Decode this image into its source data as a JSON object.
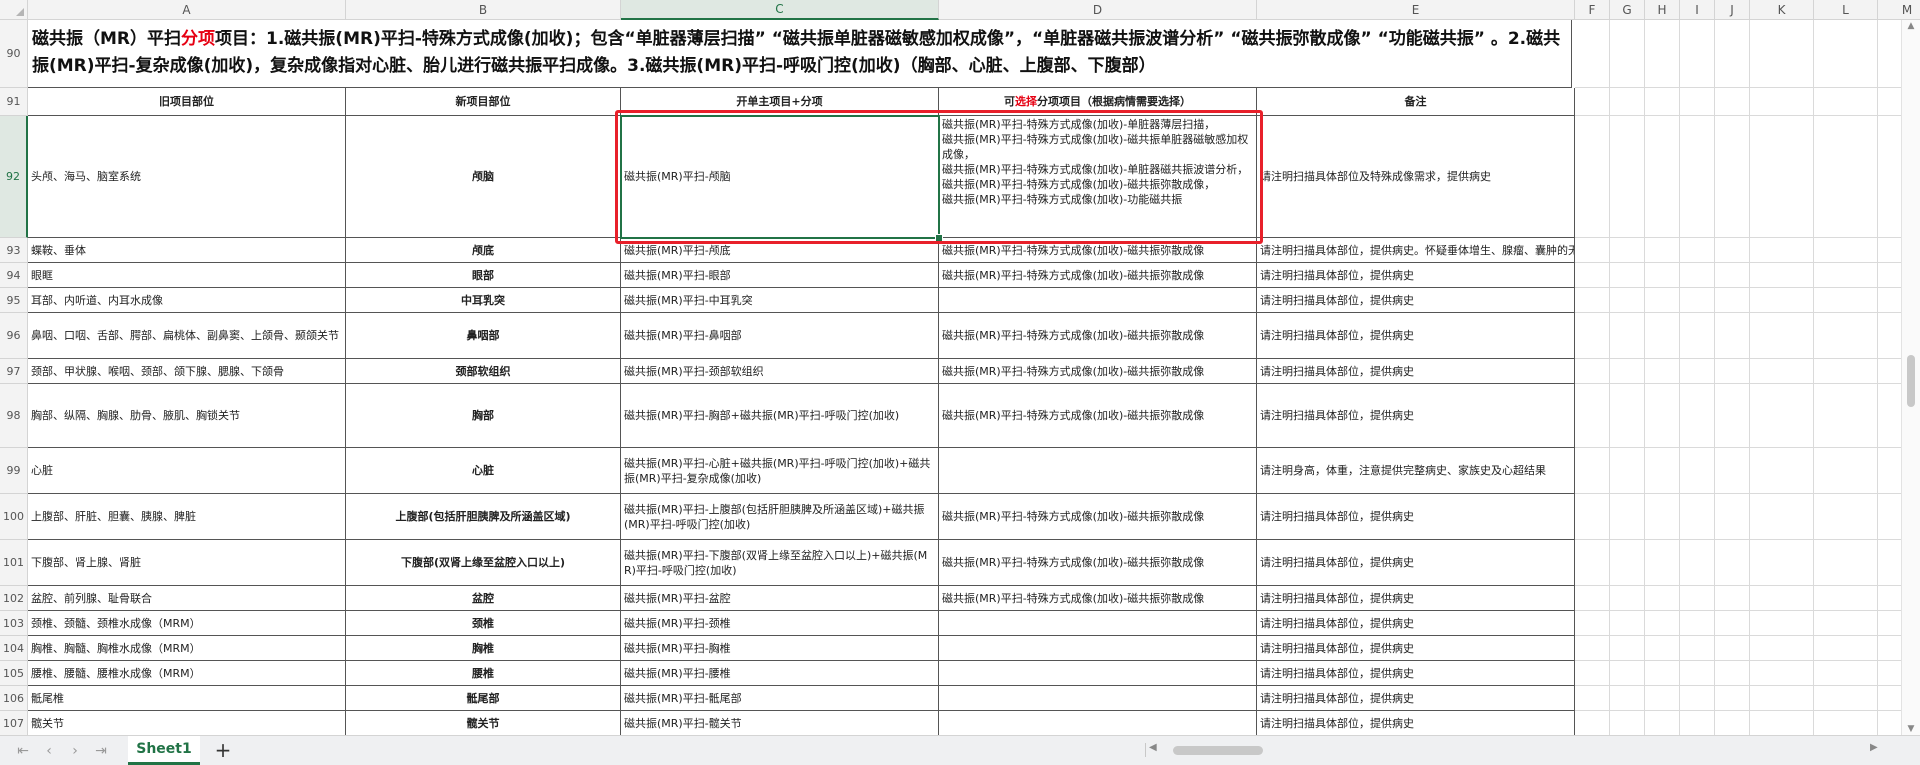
{
  "columns": [
    "A",
    "B",
    "C",
    "D",
    "E",
    "F",
    "G",
    "H",
    "I",
    "J",
    "K",
    "L",
    "M"
  ],
  "active_column": "C",
  "title": {
    "row": "90",
    "parts": [
      {
        "t": "磁共振（MR）平扫",
        "red": false
      },
      {
        "t": "分项",
        "red": true
      },
      {
        "t": "项目：1.磁共振(MR)平扫-特殊方式成像(加收)；包含“单脏器薄层扫描” “磁共振单脏器磁敏感加权成像”，“单脏器磁共振波谱分析” “磁共振弥散成像” “功能磁共振” 。2.磁共振(MR)平扫-复杂成像(加收)，复杂成像指对心脏、胎儿进行磁共振平扫成像。3.磁共振(MR)平扫-呼吸门控(加收)（胸部、心脏、上腹部、下腹部）",
        "red": false
      }
    ]
  },
  "header": {
    "row": "91",
    "cells": [
      {
        "text": "旧项目部位"
      },
      {
        "text": "新项目部位"
      },
      {
        "text": "开单主项目+分项"
      },
      {
        "pre": "可",
        "red": "选择",
        "post": "分项项目（根据病情需要选择）"
      },
      {
        "text": "备注"
      }
    ]
  },
  "rows": [
    {
      "num": "92",
      "a": "头颅、海马、脑室系统",
      "b": "颅脑",
      "c": "磁共振(MR)平扫-颅脑",
      "d": "磁共振(MR)平扫-特殊方式成像(加收)-单脏器薄层扫描，\n磁共振(MR)平扫-特殊方式成像(加收)-磁共振单脏器磁敏感加权成像，\n磁共振(MR)平扫-特殊方式成像(加收)-单脏器磁共振波谱分析，\n磁共振(MR)平扫-特殊方式成像(加收)-磁共振弥散成像，\n磁共振(MR)平扫-特殊方式成像(加收)-功能磁共振",
      "e": "请注明扫描具体部位及特殊成像需求，提供病史"
    },
    {
      "num": "93",
      "a": "蝶鞍、垂体",
      "b": "颅底",
      "c": "磁共振(MR)平扫-颅底",
      "d": "磁共振(MR)平扫-特殊方式成像(加收)-磁共振弥散成像",
      "e": "请注明扫描具体部位，提供病史。怀疑垂体增生、腺瘤、囊肿的无需平扫弥散成像"
    },
    {
      "num": "94",
      "a": "眼眶",
      "b": "眼部",
      "c": "磁共振(MR)平扫-眼部",
      "d": "磁共振(MR)平扫-特殊方式成像(加收)-磁共振弥散成像",
      "e": "请注明扫描具体部位，提供病史"
    },
    {
      "num": "95",
      "a": "耳部、内听道、内耳水成像",
      "b": "中耳乳突",
      "c": "磁共振(MR)平扫-中耳乳突",
      "d": "",
      "e": "请注明扫描具体部位，提供病史"
    },
    {
      "num": "96",
      "a": "鼻咽、口咽、舌部、腭部、扁桃体、副鼻窦、上颌骨、颞颌关节",
      "b": "鼻咽部",
      "c": "磁共振(MR)平扫-鼻咽部",
      "d": "磁共振(MR)平扫-特殊方式成像(加收)-磁共振弥散成像",
      "e": "请注明扫描具体部位，提供病史"
    },
    {
      "num": "97",
      "a": "颈部、甲状腺、喉咽、颈部、颌下腺、腮腺、下颌骨",
      "b": "颈部软组织",
      "c": "磁共振(MR)平扫-颈部软组织",
      "d": "磁共振(MR)平扫-特殊方式成像(加收)-磁共振弥散成像",
      "e": "请注明扫描具体部位，提供病史"
    },
    {
      "num": "98",
      "a": "胸部、纵隔、胸腺、肋骨、腋肌、胸锁关节",
      "b": "胸部",
      "c": "磁共振(MR)平扫-胸部+磁共振(MR)平扫-呼吸门控(加收)",
      "d": "磁共振(MR)平扫-特殊方式成像(加收)-磁共振弥散成像",
      "e": "请注明扫描具体部位，提供病史"
    },
    {
      "num": "99",
      "a": "心脏",
      "b": "心脏",
      "c": "磁共振(MR)平扫-心脏+磁共振(MR)平扫-呼吸门控(加收)+磁共振(MR)平扫-复杂成像(加收)",
      "d": "",
      "e": "请注明身高，体重，注意提供完整病史、家族史及心超结果"
    },
    {
      "num": "100",
      "a": "上腹部、肝脏、胆囊、胰腺、脾脏",
      "b": "上腹部(包括肝胆胰脾及所涵盖区域)",
      "c": "磁共振(MR)平扫-上腹部(包括肝胆胰脾及所涵盖区域)+磁共振(MR)平扫-呼吸门控(加收)",
      "d": "磁共振(MR)平扫-特殊方式成像(加收)-磁共振弥散成像",
      "e": "请注明扫描具体部位，提供病史"
    },
    {
      "num": "101",
      "a": "下腹部、肾上腺、肾脏",
      "b": "下腹部(双肾上缘至盆腔入口以上)",
      "c": "磁共振(MR)平扫-下腹部(双肾上缘至盆腔入口以上)+磁共振(MR)平扫-呼吸门控(加收)",
      "d": "磁共振(MR)平扫-特殊方式成像(加收)-磁共振弥散成像",
      "e": "请注明扫描具体部位，提供病史"
    },
    {
      "num": "102",
      "a": "盆腔、前列腺、耻骨联合",
      "b": "盆腔",
      "c": "磁共振(MR)平扫-盆腔",
      "d": "磁共振(MR)平扫-特殊方式成像(加收)-磁共振弥散成像",
      "e": "请注明扫描具体部位，提供病史"
    },
    {
      "num": "103",
      "a": "颈椎、颈髓、颈椎水成像（MRM）",
      "b": "颈椎",
      "c": "磁共振(MR)平扫-颈椎",
      "d": "",
      "e": "请注明扫描具体部位，提供病史"
    },
    {
      "num": "104",
      "a": "胸椎、胸髓、胸椎水成像（MRM）",
      "b": "胸椎",
      "c": "磁共振(MR)平扫-胸椎",
      "d": "",
      "e": "请注明扫描具体部位，提供病史"
    },
    {
      "num": "105",
      "a": "腰椎、腰髓、腰椎水成像（MRM）",
      "b": "腰椎",
      "c": "磁共振(MR)平扫-腰椎",
      "d": "",
      "e": "请注明扫描具体部位，提供病史"
    },
    {
      "num": "106",
      "a": "骶尾椎",
      "b": "骶尾部",
      "c": "磁共振(MR)平扫-骶尾部",
      "d": "",
      "e": "请注明扫描具体部位，提供病史"
    },
    {
      "num": "107",
      "a": "髋关节",
      "b": "髋关节",
      "c": "磁共振(MR)平扫-髋关节",
      "d": "",
      "e": "请注明扫描具体部位，提供病史"
    }
  ],
  "sheet_tab": "Sheet1",
  "colors": {
    "accent": "#217346",
    "annotation": "#e8202a",
    "red_text": "#e60012"
  }
}
